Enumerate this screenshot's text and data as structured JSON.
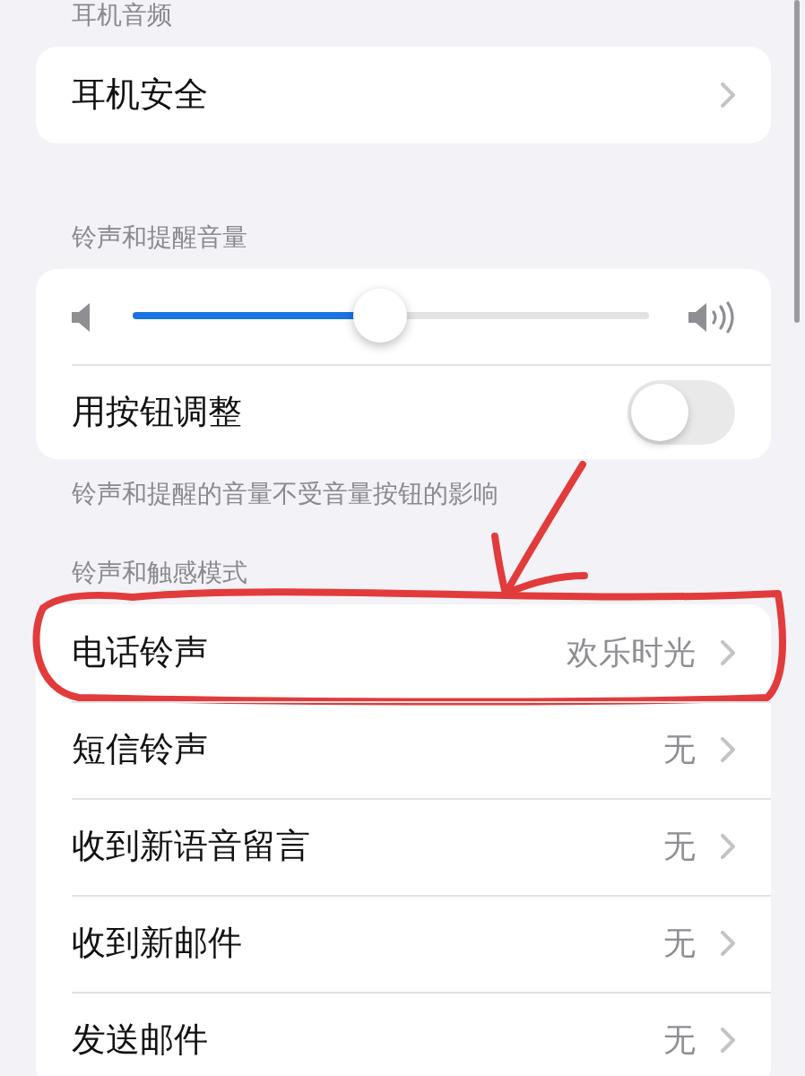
{
  "sections": [
    {
      "header": "耳机音频",
      "rows": [
        {
          "kind": "link",
          "label": "耳机安全",
          "circled": false
        }
      ]
    },
    {
      "header": "铃声和提醒音量",
      "rows": [
        {
          "kind": "slider",
          "level": 0.48
        },
        {
          "kind": "toggle",
          "label": "用按钮调整",
          "on": false
        }
      ],
      "footer": "铃声和提醒的音量不受音量按钮的影响"
    },
    {
      "header": "铃声和触感模式",
      "rows": [
        {
          "kind": "link",
          "label": "电话铃声",
          "value": "欢乐时光",
          "circled": true
        },
        {
          "kind": "link",
          "label": "短信铃声",
          "value": "无",
          "circled": false
        },
        {
          "kind": "link",
          "label": "收到新语音留言",
          "value": "无",
          "circled": false
        },
        {
          "kind": "link",
          "label": "收到新邮件",
          "value": "无",
          "circled": false
        },
        {
          "kind": "link",
          "label": "发送邮件",
          "value": "无",
          "circled": false
        }
      ]
    }
  ]
}
